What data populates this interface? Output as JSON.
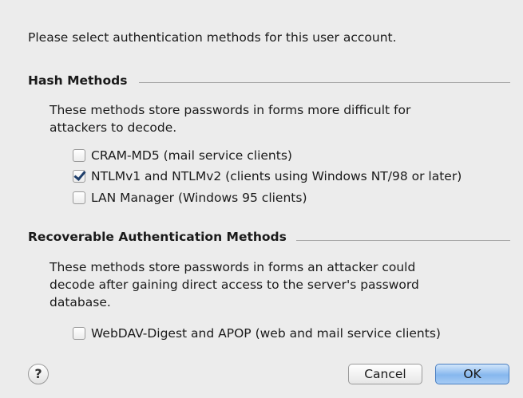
{
  "intro": "Please select authentication methods for this user account.",
  "hash_section": {
    "title": "Hash Methods",
    "description_lines": [
      "These methods store passwords in forms more difficult for",
      "attackers to decode."
    ],
    "options": [
      {
        "label": "CRAM-MD5 (mail service clients)",
        "checked": false
      },
      {
        "label": "NTLMv1 and NTLMv2 (clients using Windows NT/98 or later)",
        "checked": true
      },
      {
        "label": "LAN Manager (Windows 95 clients)",
        "checked": false
      }
    ]
  },
  "recoverable_section": {
    "title": "Recoverable Authentication Methods",
    "description_lines": [
      "These methods store passwords in forms an attacker could",
      "decode after gaining direct access to the server's password",
      "database."
    ],
    "options": [
      {
        "label": "WebDAV-Digest and APOP (web and mail service clients)",
        "checked": false
      }
    ]
  },
  "buttons": {
    "help": "?",
    "cancel": "Cancel",
    "ok": "OK"
  }
}
